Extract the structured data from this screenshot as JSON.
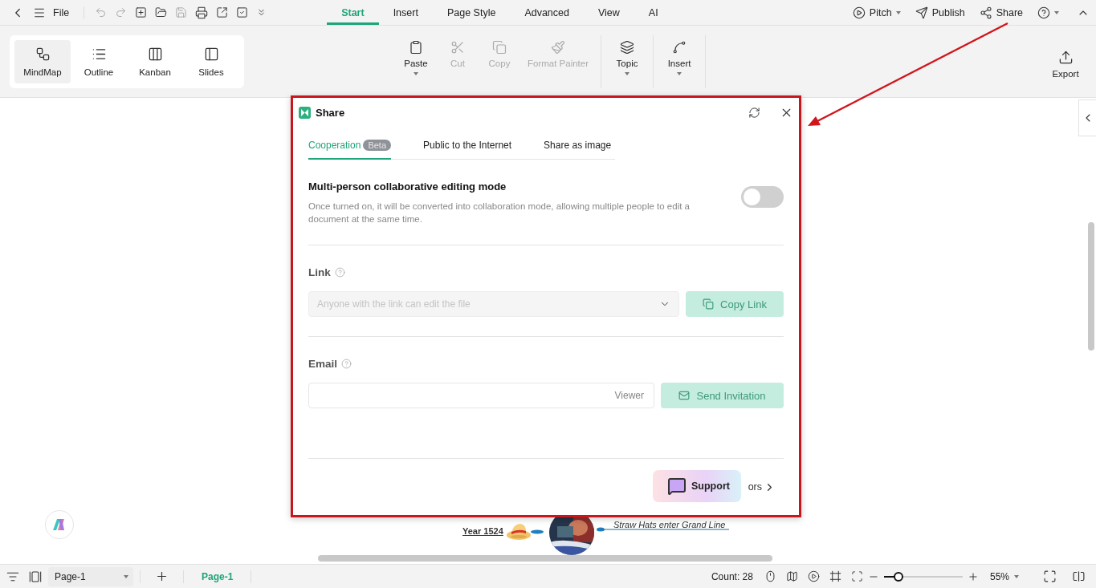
{
  "menu_bar": {
    "file_label": "File",
    "tabs": [
      {
        "label": "Start",
        "selected": true
      },
      {
        "label": "Insert",
        "selected": false
      },
      {
        "label": "Page Style",
        "selected": false
      },
      {
        "label": "Advanced",
        "selected": false
      },
      {
        "label": "View",
        "selected": false
      },
      {
        "label": "AI",
        "selected": false
      }
    ],
    "actions": [
      {
        "kind": "pitch",
        "label": "Pitch",
        "dropdown": true
      },
      {
        "kind": "publish",
        "label": "Publish",
        "dropdown": false
      },
      {
        "kind": "share",
        "label": "Share",
        "dropdown": false
      }
    ]
  },
  "view_modes": [
    {
      "kind": "mindmap",
      "label": "MindMap",
      "selected": true
    },
    {
      "kind": "outline",
      "label": "Outline",
      "selected": false
    },
    {
      "kind": "kanban",
      "label": "Kanban",
      "selected": false
    },
    {
      "kind": "slides",
      "label": "Slides",
      "selected": false
    }
  ],
  "ribbon": {
    "groups": [
      {
        "tools": [
          {
            "kind": "paste",
            "label": "Paste",
            "disabled": false,
            "dropdown": true
          },
          {
            "kind": "cut",
            "label": "Cut",
            "disabled": true,
            "dropdown": false
          },
          {
            "kind": "copy",
            "label": "Copy",
            "disabled": true,
            "dropdown": false
          },
          {
            "kind": "painter",
            "label": "Format Painter",
            "disabled": true,
            "dropdown": false
          }
        ]
      },
      {
        "tools": [
          {
            "kind": "topic",
            "label": "Topic",
            "disabled": false,
            "dropdown": true
          }
        ]
      },
      {
        "tools": [
          {
            "kind": "insert",
            "label": "Insert",
            "disabled": false,
            "dropdown": true
          }
        ]
      }
    ],
    "export_label": "Export"
  },
  "canvas": {
    "date_label": "Year 1524",
    "event_label": "Straw Hats enter Grand Line"
  },
  "dialog": {
    "title": "Share",
    "tabs": [
      {
        "label": "Cooperation",
        "badge": "Beta",
        "selected": true
      },
      {
        "label": "Public to the Internet",
        "selected": false
      },
      {
        "label": "Share as image",
        "selected": false
      }
    ],
    "mode": {
      "title": "Multi-person collaborative editing mode",
      "description": "Once turned on, it will be converted into collaboration mode, allowing multiple people to edit a document at the same time.",
      "on": false
    },
    "link": {
      "label": "Link",
      "placeholder": "Anyone with the link can edit the file",
      "button": "Copy Link",
      "disabled": true
    },
    "email": {
      "label": "Email",
      "role": "Viewer",
      "button": "Send Invitation",
      "disabled": true
    },
    "footer_link": "ors",
    "support": "Support"
  },
  "status_bar": {
    "page_select": "Page-1",
    "pages": [
      {
        "label": "Page-1",
        "selected": true
      }
    ],
    "count": "Count: 28",
    "zoom": {
      "level": 0.18,
      "reading": "55%"
    }
  }
}
